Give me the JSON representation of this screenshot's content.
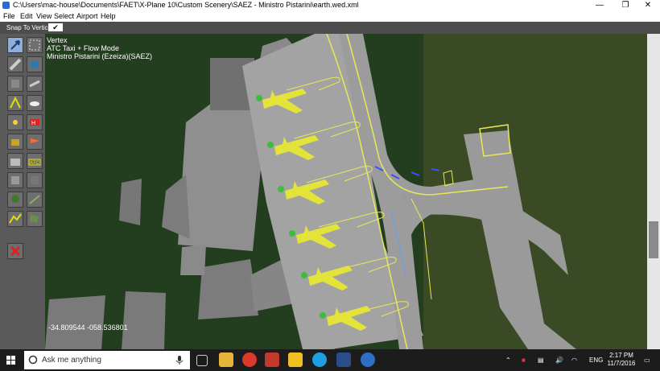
{
  "window": {
    "title": "C:\\Users\\mac-house\\Documents\\FAET\\X-Plane 10\\Custom Scenery\\SAEZ - Ministro Pistarini\\earth.wed.xml",
    "minimize": "—",
    "maximize": "❐",
    "close": "✕"
  },
  "menu": [
    "File",
    "Edit",
    "View",
    "Select",
    "Airport",
    "Help"
  ],
  "options": {
    "snap_label": "Snap To Vertices",
    "snap_state": "✔"
  },
  "tools": [
    {
      "icon": "marquee-icon"
    },
    {
      "icon": "vertex-tool-icon"
    },
    {
      "icon": "taxiway-icon"
    },
    {
      "icon": "runway-icon"
    },
    {
      "icon": "boundary-icon"
    },
    {
      "icon": "helipad-icon"
    },
    {
      "icon": "sign-icon"
    },
    {
      "icon": "light-icon"
    },
    {
      "icon": "objects-icon"
    },
    {
      "icon": "windsock-icon"
    },
    {
      "icon": "facade-icon"
    },
    {
      "icon": "atc-icon"
    },
    {
      "icon": "forest-icon"
    },
    {
      "icon": "line-icon"
    },
    {
      "icon": "string-icon"
    },
    {
      "icon": "polygon-icon"
    },
    {
      "icon": "exclusion-icon"
    }
  ],
  "info": {
    "line1": "Vertex",
    "line2": "ATC Taxi + Flow Mode",
    "line3": "Ministro Pistarini (Ezeiza)(SAEZ)"
  },
  "coordinates": "-34.809544 -058.536801",
  "taskbar": {
    "search_placeholder": "Ask me anything",
    "language": "ENG",
    "time": "2:17 PM",
    "date": "11/7/2016"
  },
  "colors": {
    "grass": "#233d1f",
    "concrete": "#9b9b9b",
    "aircraft": "#e3e33a",
    "taxi_lines": "#e8e858",
    "selection": "#8faed8"
  }
}
